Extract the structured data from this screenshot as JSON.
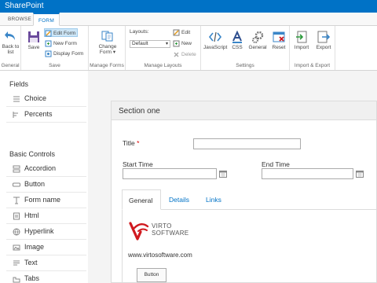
{
  "app": {
    "title": "SharePoint"
  },
  "tabs": [
    {
      "label": "BROWSE",
      "active": false
    },
    {
      "label": "FORM",
      "active": true
    }
  ],
  "ribbon": {
    "general": {
      "back_label_1": "Back to",
      "back_label_2": "list",
      "group_name": "General"
    },
    "save": {
      "save_label": "Save",
      "edit_form": "Edit Form",
      "new_form": "New Form",
      "display_form": "Display Form",
      "group_name": "Save"
    },
    "manage_forms": {
      "change_form_1": "Change",
      "change_form_2": "Form",
      "group_name": "Manage Forms"
    },
    "manage_layouts": {
      "layouts_label": "Layouts:",
      "layout_value": "Default",
      "edit": "Edit",
      "new": "New",
      "delete": "Delete",
      "group_name": "Manage Layouts"
    },
    "settings": {
      "javascript": "JavaScript",
      "css": "CSS",
      "general": "General",
      "reset": "Reset",
      "group_name": "Settings"
    },
    "import_export": {
      "import": "Import",
      "export": "Export",
      "group_name": "Import & Export"
    }
  },
  "sidebar": {
    "fields_title": "Fields",
    "fields": [
      {
        "label": "Choice",
        "icon": "choice-icon"
      },
      {
        "label": "Percents",
        "icon": "percents-icon"
      }
    ],
    "controls_title": "Basic Controls",
    "controls": [
      {
        "label": "Accordion",
        "icon": "accordion-icon"
      },
      {
        "label": "Button",
        "icon": "button-icon"
      },
      {
        "label": "Form name",
        "icon": "form-name-icon"
      },
      {
        "label": "Html",
        "icon": "html-icon"
      },
      {
        "label": "Hyperlink",
        "icon": "hyperlink-icon"
      },
      {
        "label": "Image",
        "icon": "image-icon"
      },
      {
        "label": "Text",
        "icon": "text-icon"
      },
      {
        "label": "Tabs",
        "icon": "tabs-icon"
      }
    ]
  },
  "form": {
    "section_title": "Section one",
    "title_label": "Title",
    "required_mark": "*",
    "start_time_label": "Start Time",
    "end_time_label": "End Time",
    "tabs": [
      "General",
      "Details",
      "Links"
    ],
    "logo_line1": "VIRTO",
    "logo_line2": "SOFTWARE",
    "site_url": "www.virtosoftware.com",
    "button_label": "Button"
  },
  "colors": {
    "brand": "#0072c6",
    "logo_red": "#d0191f"
  }
}
